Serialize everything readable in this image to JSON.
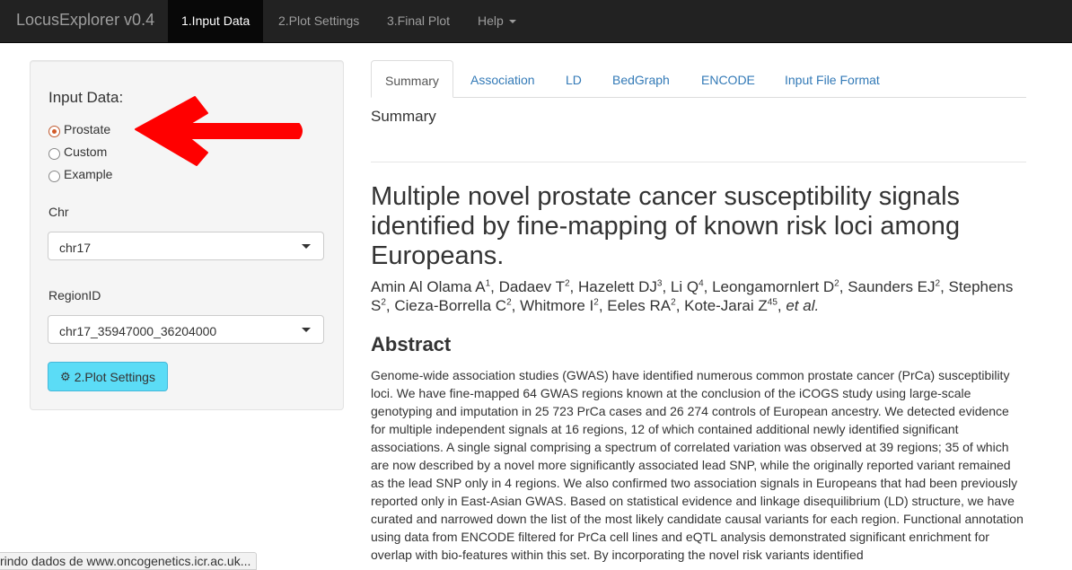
{
  "navbar": {
    "brand": "LocusExplorer v0.4",
    "items": [
      {
        "label": "1.Input Data",
        "active": true
      },
      {
        "label": "2.Plot Settings",
        "active": false
      },
      {
        "label": "3.Final Plot",
        "active": false
      },
      {
        "label": "Help",
        "active": false
      }
    ]
  },
  "sidebar": {
    "input_label": "Input Data:",
    "radios": [
      {
        "label": "Prostate",
        "checked": true
      },
      {
        "label": "Custom",
        "checked": false
      },
      {
        "label": "Example",
        "checked": false
      }
    ],
    "chr_label": "Chr",
    "chr_value": "chr17",
    "region_label": "RegionID",
    "region_value": "chr17_35947000_36204000",
    "plot_button": "2.Plot Settings",
    "plot_button_icon": "gears-icon"
  },
  "annotation": {
    "arrow_color": "#ff0000"
  },
  "tabs": [
    {
      "label": "Summary",
      "active": true
    },
    {
      "label": "Association",
      "active": false
    },
    {
      "label": "LD",
      "active": false
    },
    {
      "label": "BedGraph",
      "active": false
    },
    {
      "label": "ENCODE",
      "active": false
    },
    {
      "label": "Input File Format",
      "active": false
    }
  ],
  "main": {
    "heading": "Summary",
    "paper_title": "Multiple novel prostate cancer susceptibility signals identified by fine-mapping of known risk loci among Europeans.",
    "authors": [
      {
        "name": "Amin Al Olama A",
        "sup": "1"
      },
      {
        "name": "Dadaev T",
        "sup": "2"
      },
      {
        "name": "Hazelett DJ",
        "sup": "3"
      },
      {
        "name": "Li Q",
        "sup": "4"
      },
      {
        "name": "Leongamornlert D",
        "sup": "2"
      },
      {
        "name": "Saunders EJ",
        "sup": "2"
      },
      {
        "name": "Stephens S",
        "sup": "2"
      },
      {
        "name": "Cieza-Borrella C",
        "sup": "2"
      },
      {
        "name": "Whitmore I",
        "sup": "2"
      },
      {
        "name": "Eeles RA",
        "sup": "2"
      },
      {
        "name": "Kote-Jarai Z",
        "sup": "45"
      }
    ],
    "authors_etal": "et al.",
    "abstract_heading": "Abstract",
    "abstract_text": "Genome-wide association studies (GWAS) have identified numerous common prostate cancer (PrCa) susceptibility loci. We have fine-mapped 64 GWAS regions known at the conclusion of the iCOGS study using large-scale genotyping and imputation in 25 723 PrCa cases and 26 274 controls of European ancestry. We detected evidence for multiple independent signals at 16 regions, 12 of which contained additional newly identified significant associations. A single signal comprising a spectrum of correlated variation was observed at 39 regions; 35 of which are now described by a novel more significantly associated lead SNP, while the originally reported variant remained as the lead SNP only in 4 regions. We also confirmed two association signals in Europeans that had been previously reported only in East-Asian GWAS. Based on statistical evidence and linkage disequilibrium (LD) structure, we have curated and narrowed down the list of the most likely candidate causal variants for each region. Functional annotation using data from ENCODE filtered for PrCa cell lines and eQTL analysis demonstrated significant enrichment for overlap with bio-features within this set. By incorporating the novel risk variants identified"
  },
  "status": "rindo dados de www.oncogenetics.icr.ac.uk..."
}
